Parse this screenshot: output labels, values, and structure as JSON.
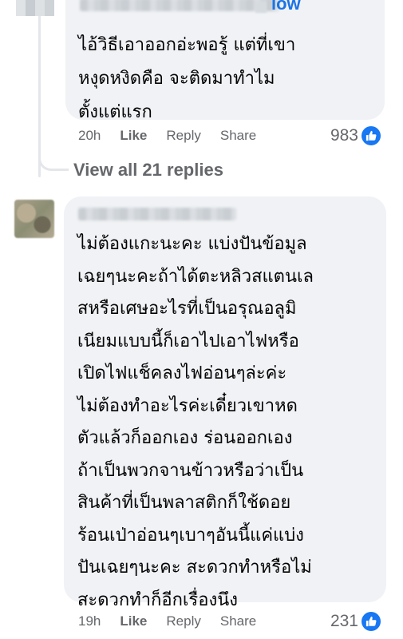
{
  "comments": [
    {
      "follow_label": "low",
      "body": "ไอ้วิธีเอาออกอ่ะพอรู้ แต่ที่เขา\nหงุดหงิดคือ จะติดมาทำไม\nตั้งแต่แรก",
      "time": "20h",
      "like_label": "Like",
      "reply_label": "Reply",
      "share_label": "Share",
      "reaction_count": "983"
    },
    {
      "body": "ไม่ต้องแกะนะคะ แบ่งปันข้อมูล\nเฉยๆนะคะถ้าได้ตะหลิวสแตนเล\nสหรือเศษอะไรที่เป็นอรุณอลูมิ\nเนียมแบบนี้ก็เอาไปเอาไฟหรือ\nเปิดไฟแช็คลงไฟอ่อนๆล่ะค่ะ\nไม่ต้องทำอะไรค่ะเดี๋ยวเขาหด\nตัวแล้วก็ออกเอง ร่อนออกเอง\nถ้าเป็นพวกจานข้าวหรือว่าเป็น\nสินค้าที่เป็นพลาสติกก็ใช้ดอย\nร้อนเป่าอ่อนๆเบาๆอันนี้แค่แบ่ง\nปันเฉยๆนะคะ สะดวกทำหรือไม่\nสะดวกทำก็อีกเรื่องนึง",
      "time": "19h",
      "like_label": "Like",
      "reply_label": "Reply",
      "share_label": "Share",
      "reaction_count": "231"
    }
  ],
  "view_replies_label": "View all 21 replies",
  "colors": {
    "bubble": "#f0f2f5",
    "link": "#1b74e4",
    "meta": "#65676b",
    "like_badge": "#1877f2"
  },
  "icons": {
    "reaction": "thumbs-up-icon"
  }
}
